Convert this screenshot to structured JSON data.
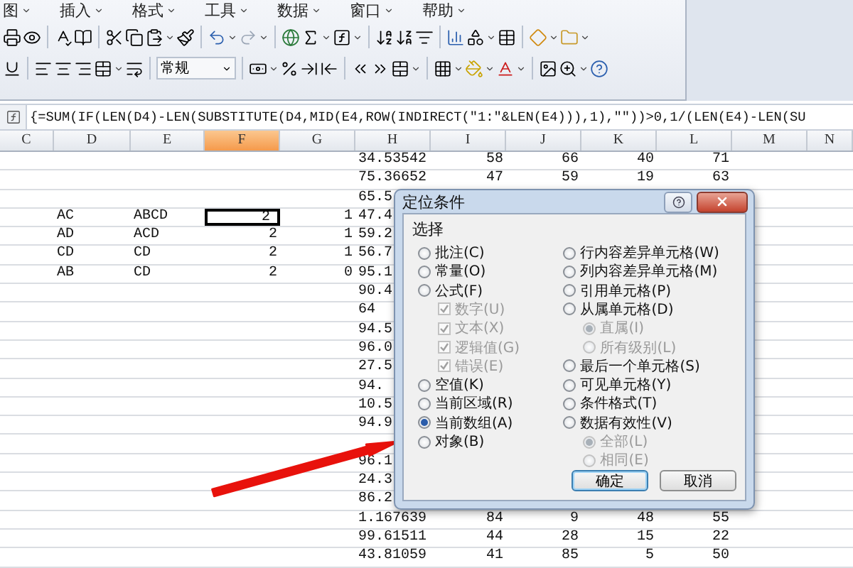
{
  "menu": [
    {
      "label": "图"
    },
    {
      "label": "插入"
    },
    {
      "label": "格式"
    },
    {
      "label": "工具"
    },
    {
      "label": "数据"
    },
    {
      "label": "窗口"
    },
    {
      "label": "帮助"
    }
  ],
  "toolbar": {
    "number_format": "常规"
  },
  "formula_bar": {
    "formula": "{=SUM(IF(LEN(D4)-LEN(SUBSTITUTE(D4,MID(E4,ROW(INDIRECT(\"1:\"&LEN(E4))),1),\"\"))>0,1/(LEN(E4)-LEN(SU"
  },
  "columns": [
    {
      "label": "C",
      "selected": false
    },
    {
      "label": "D",
      "selected": false
    },
    {
      "label": "E",
      "selected": false
    },
    {
      "label": "F",
      "selected": true
    },
    {
      "label": "G",
      "selected": false
    },
    {
      "label": "H",
      "selected": false
    },
    {
      "label": "I",
      "selected": false
    },
    {
      "label": "J",
      "selected": false
    },
    {
      "label": "K",
      "selected": false
    },
    {
      "label": "L",
      "selected": false
    },
    {
      "label": "M",
      "selected": false
    },
    {
      "label": "N",
      "selected": false
    }
  ],
  "rows": [
    {
      "selected": false,
      "cells": [
        null,
        null,
        null,
        null,
        null,
        "34.53542",
        "58",
        "66",
        "40",
        "71",
        null,
        null
      ]
    },
    {
      "selected": false,
      "cells": [
        null,
        null,
        null,
        null,
        null,
        "75.36652",
        "47",
        "59",
        "19",
        "63",
        null,
        null
      ]
    },
    {
      "selected": false,
      "cells": [
        null,
        null,
        null,
        null,
        null,
        "65.5",
        null,
        null,
        null,
        null,
        null,
        null
      ]
    },
    {
      "selected": true,
      "cells": [
        null,
        "AC",
        "ABCD",
        "2",
        "1",
        "47.4",
        null,
        null,
        null,
        null,
        null,
        null
      ]
    },
    {
      "selected": false,
      "cells": [
        null,
        "AD",
        "ACD",
        "2",
        "1",
        "59.2",
        null,
        null,
        null,
        null,
        null,
        null
      ]
    },
    {
      "selected": false,
      "cells": [
        null,
        "CD",
        "CD",
        "2",
        "1",
        "56.7",
        null,
        null,
        null,
        null,
        null,
        null
      ]
    },
    {
      "selected": false,
      "cells": [
        null,
        "AB",
        "CD",
        "2",
        "0",
        "95.1",
        null,
        null,
        null,
        null,
        null,
        null
      ]
    },
    {
      "selected": false,
      "cells": [
        null,
        null,
        null,
        null,
        null,
        "90.4",
        null,
        null,
        null,
        null,
        null,
        null
      ]
    },
    {
      "selected": false,
      "cells": [
        null,
        null,
        null,
        null,
        null,
        "64",
        null,
        null,
        null,
        null,
        null,
        null
      ]
    },
    {
      "selected": false,
      "cells": [
        null,
        null,
        null,
        null,
        null,
        "94.5",
        null,
        null,
        null,
        null,
        null,
        null
      ]
    },
    {
      "selected": false,
      "cells": [
        null,
        null,
        null,
        null,
        null,
        "96.0",
        null,
        null,
        null,
        null,
        null,
        null
      ]
    },
    {
      "selected": false,
      "cells": [
        null,
        null,
        null,
        null,
        null,
        "27.5",
        null,
        null,
        null,
        null,
        null,
        null
      ]
    },
    {
      "selected": false,
      "cells": [
        null,
        null,
        null,
        null,
        null,
        "94.",
        null,
        null,
        null,
        null,
        null,
        null
      ]
    },
    {
      "selected": false,
      "cells": [
        null,
        null,
        null,
        null,
        null,
        "10.5",
        null,
        null,
        null,
        null,
        null,
        null
      ]
    },
    {
      "selected": false,
      "cells": [
        null,
        null,
        null,
        null,
        null,
        "94.9",
        null,
        null,
        null,
        null,
        null,
        null
      ]
    },
    {
      "selected": false,
      "cells": [
        null,
        null,
        null,
        null,
        null,
        null,
        null,
        null,
        null,
        null,
        null,
        null
      ]
    },
    {
      "selected": false,
      "cells": [
        null,
        null,
        null,
        null,
        null,
        "96.1",
        null,
        null,
        null,
        null,
        null,
        null
      ]
    },
    {
      "selected": false,
      "cells": [
        null,
        null,
        null,
        null,
        null,
        "24.3",
        null,
        null,
        null,
        null,
        null,
        null
      ]
    },
    {
      "selected": false,
      "cells": [
        null,
        null,
        null,
        null,
        null,
        "86.2",
        null,
        null,
        null,
        null,
        null,
        null
      ]
    },
    {
      "selected": false,
      "cells": [
        null,
        null,
        null,
        null,
        null,
        "1.167639",
        "84",
        "9",
        "48",
        "55",
        null,
        null
      ]
    },
    {
      "selected": false,
      "cells": [
        null,
        null,
        null,
        null,
        null,
        "99.61511",
        "44",
        "28",
        "15",
        "22",
        null,
        null
      ]
    },
    {
      "selected": false,
      "cells": [
        null,
        null,
        null,
        null,
        null,
        "43.81059",
        "41",
        "85",
        "5",
        "50",
        null,
        null
      ]
    }
  ],
  "dialog": {
    "title": "定位条件",
    "group_label": "选择",
    "left_options": [
      {
        "kind": "radio",
        "label": "批注(C)",
        "selected": false,
        "disabled": false
      },
      {
        "kind": "radio",
        "label": "常量(O)",
        "selected": false,
        "disabled": false
      },
      {
        "kind": "radio",
        "label": "公式(F)",
        "selected": false,
        "disabled": false,
        "children": [
          {
            "kind": "checkbox",
            "label": "数字(U)",
            "checked": true,
            "disabled": true
          },
          {
            "kind": "checkbox",
            "label": "文本(X)",
            "checked": true,
            "disabled": true
          },
          {
            "kind": "checkbox",
            "label": "逻辑值(G)",
            "checked": true,
            "disabled": true
          },
          {
            "kind": "checkbox",
            "label": "错误(E)",
            "checked": true,
            "disabled": true
          }
        ]
      },
      {
        "kind": "radio",
        "label": "空值(K)",
        "selected": false,
        "disabled": false
      },
      {
        "kind": "radio",
        "label": "当前区域(R)",
        "selected": false,
        "disabled": false
      },
      {
        "kind": "radio",
        "label": "当前数组(A)",
        "selected": true,
        "disabled": false
      },
      {
        "kind": "radio",
        "label": "对象(B)",
        "selected": false,
        "disabled": false
      }
    ],
    "right_options": [
      {
        "kind": "radio",
        "label": "行内容差异单元格(W)",
        "selected": false,
        "disabled": false
      },
      {
        "kind": "radio",
        "label": "列内容差异单元格(M)",
        "selected": false,
        "disabled": false
      },
      {
        "kind": "radio",
        "label": "引用单元格(P)",
        "selected": false,
        "disabled": false
      },
      {
        "kind": "radio",
        "label": "从属单元格(D)",
        "selected": false,
        "disabled": false,
        "children": [
          {
            "kind": "radio",
            "label": "直属(I)",
            "selected": true,
            "disabled": true
          },
          {
            "kind": "radio",
            "label": "所有级别(L)",
            "selected": false,
            "disabled": true
          }
        ]
      },
      {
        "kind": "radio",
        "label": "最后一个单元格(S)",
        "selected": false,
        "disabled": false
      },
      {
        "kind": "radio",
        "label": "可见单元格(Y)",
        "selected": false,
        "disabled": false
      },
      {
        "kind": "radio",
        "label": "条件格式(T)",
        "selected": false,
        "disabled": false
      },
      {
        "kind": "radio",
        "label": "数据有效性(V)",
        "selected": false,
        "disabled": false,
        "children": [
          {
            "kind": "radio",
            "label": "全部(L)",
            "selected": true,
            "disabled": true
          },
          {
            "kind": "radio",
            "label": "相同(E)",
            "selected": false,
            "disabled": true
          }
        ]
      }
    ],
    "buttons": [
      {
        "label": "确定",
        "default": true
      },
      {
        "label": "取消",
        "default": false
      }
    ]
  }
}
